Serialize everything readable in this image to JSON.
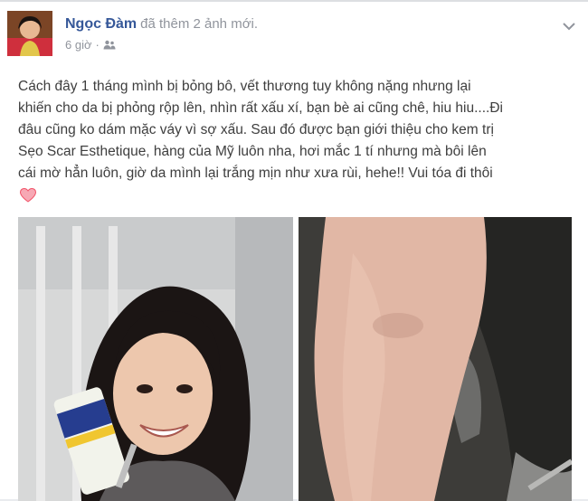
{
  "post": {
    "author": "Ngọc Đàm",
    "action": "đã thêm 2 ảnh mới.",
    "time": "6 giờ",
    "privacy_icon": "friends-icon",
    "menu_icon": "chevron-down-icon",
    "body_lines": [
      "Cách đây 1 tháng mình bị bỏng bô, vết thương tuy không nặng nhưng lại",
      "khiến cho da bị phỏng rộp lên, nhìn rất xấu xí, bạn bè ai cũng chê, hiu hiu....Đi",
      "đâu cũng ko dám mặc váy vì sợ xấu. Sau đó được bạn giới thiệu cho kem trị",
      "Sẹo Scar Esthetique, hàng của Mỹ luôn nha, hơi mắc 1 tí nhưng mà bôi lên",
      "cái mờ hẳn luôn, giờ da mình lại trắng mịn như xưa rùi, hehe!! Vui tóa đi thôi"
    ],
    "emoji": "heart-icon"
  },
  "colors": {
    "author": "#365899",
    "meta": "#90949c",
    "heart": "#f25268"
  }
}
